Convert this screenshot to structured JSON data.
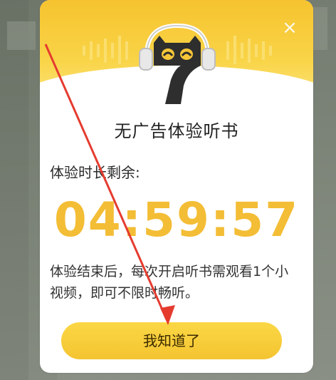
{
  "dialog": {
    "close_icon": "close-icon",
    "close_glyph": "×",
    "title": "无广告体验听书",
    "remaining_label": "体验时长剩余:",
    "timer": "04:59:57",
    "description": "体验结束后，每次开启听书需观看1个小视频，即可不限时畅听。",
    "ok_button": "我知道了"
  },
  "colors": {
    "accent": "#f3bd35",
    "header_yellow": "#f6c32f",
    "button_yellow": "#fbd745",
    "annotation_red": "#e53b2f"
  }
}
